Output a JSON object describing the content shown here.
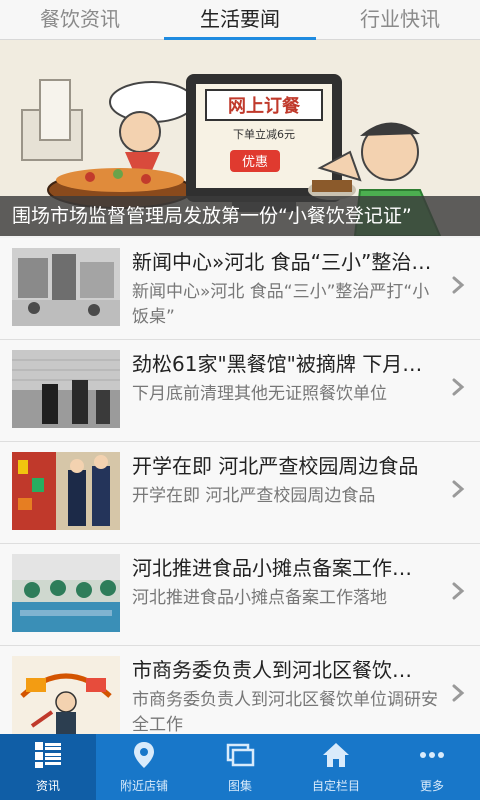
{
  "tabs": [
    {
      "label": "餐饮资讯",
      "active": false
    },
    {
      "label": "生活要闻",
      "active": true
    },
    {
      "label": "行业快讯",
      "active": false
    }
  ],
  "banner": {
    "caption": "围场市场监督管理局发放第一份“小餐饮登记证”",
    "sign_text": "网上订餐",
    "sign_sub": "下单立减6元",
    "tag_text": "优惠"
  },
  "news": [
    {
      "title": "新闻中心»河北 食品“三小”整治…",
      "summary": "新闻中心»河北 食品“三小”整治严打“小饭桌”"
    },
    {
      "title": "劲松61家\"黑餐馆\"被摘牌 下月…",
      "summary": "下月底前清理其他无证照餐饮单位"
    },
    {
      "title": "开学在即 河北严查校园周边食品",
      "summary": "开学在即 河北严查校园周边食品"
    },
    {
      "title": "河北推进食品小摊点备案工作…",
      "summary": "河北推进食品小摊点备案工作落地"
    },
    {
      "title": "市商务委负责人到河北区餐饮…",
      "summary": "市商务委负责人到河北区餐饮单位调研安全工作"
    }
  ],
  "nav": [
    {
      "label": "资讯",
      "icon": "grid-icon",
      "active": true
    },
    {
      "label": "附近店铺",
      "icon": "location-pin-icon",
      "active": false
    },
    {
      "label": "图集",
      "icon": "gallery-icon",
      "active": false
    },
    {
      "label": "自定栏目",
      "icon": "home-icon",
      "active": false
    },
    {
      "label": "更多",
      "icon": "more-dots-icon",
      "active": false
    }
  ],
  "colors": {
    "accent": "#1f8be0",
    "nav_bg": "#1877c9",
    "nav_active_bg": "#105ea6"
  }
}
